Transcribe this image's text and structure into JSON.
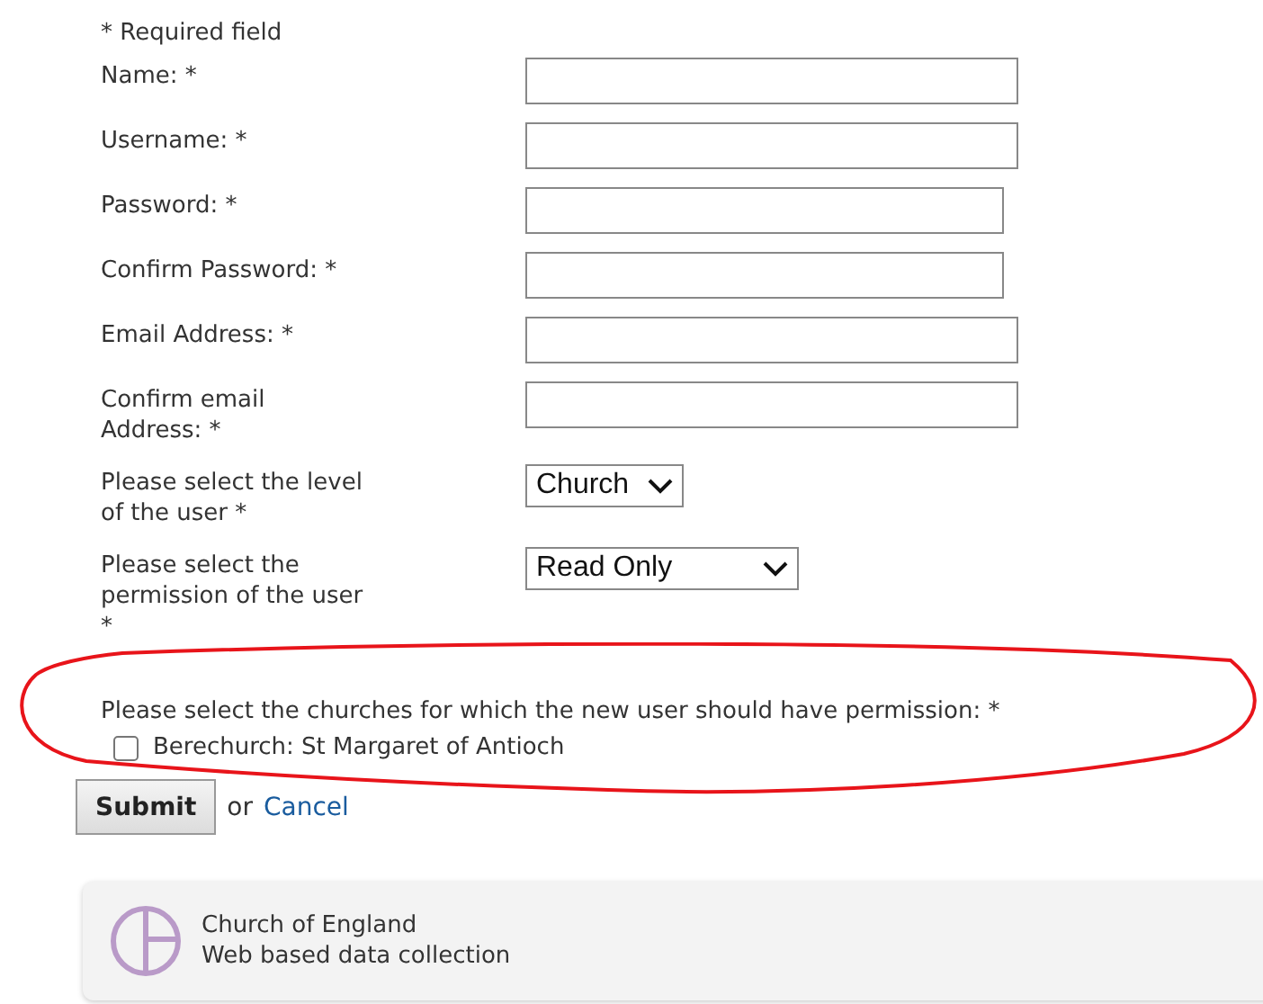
{
  "required_note": "* Required field",
  "fields": [
    {
      "kind": "text",
      "label": "Name: *"
    },
    {
      "kind": "text",
      "label": "Username: *"
    },
    {
      "kind": "text",
      "label": "Password: *"
    },
    {
      "kind": "text",
      "label": "Confirm Password: *"
    },
    {
      "kind": "text",
      "label": "Email Address: *"
    },
    {
      "kind": "text",
      "label": "Confirm email Address: *"
    },
    {
      "kind": "select",
      "label": "Please select the level of the user *",
      "value": "Church"
    },
    {
      "kind": "select",
      "label": "Please select the permission of the user *",
      "value": "Read Only"
    }
  ],
  "churches": {
    "label": "Please select the churches for which the new user should have permission:  *",
    "items": [
      {
        "label": "Berechurch: St Margaret of Antioch",
        "checked": false
      }
    ]
  },
  "actions": {
    "submit": "Submit",
    "separator": "or",
    "cancel": "Cancel"
  },
  "footer": {
    "lines": [
      "Church of England",
      "Web based data collection"
    ]
  }
}
